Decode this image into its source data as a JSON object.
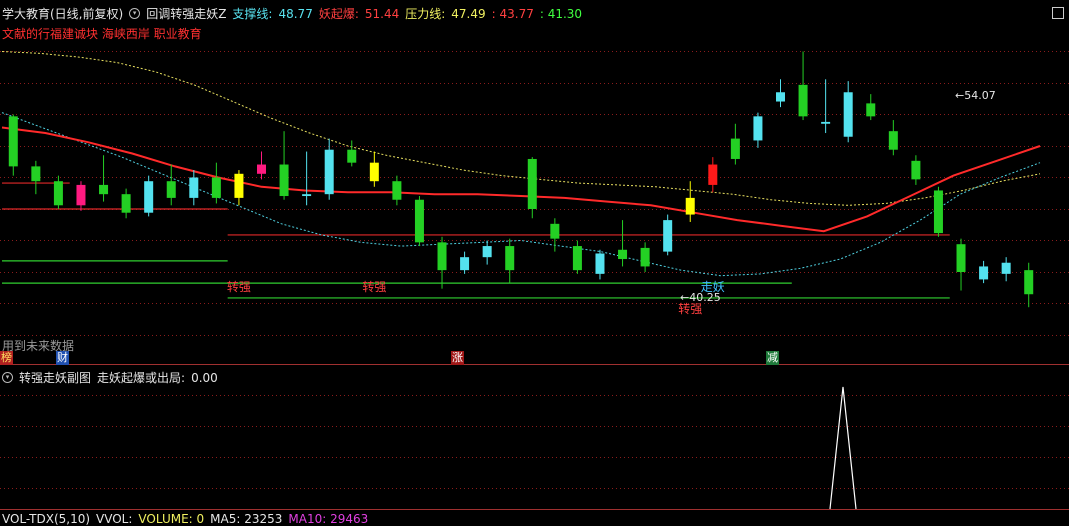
{
  "header": {
    "title": "学大教育(日线,前复权)",
    "indicator_name": "回调转强走妖Z",
    "support_label": "支撑线:",
    "support_value": "48.77",
    "yao_label": "妖起爆:",
    "yao_value": "51.44",
    "pressure_label": "压力线:",
    "pressure_value": "47.49",
    "v1": ": 43.77",
    "v2": ": 41.30"
  },
  "watermark": "文献的行福建诚块 海峡西岸 职业教育",
  "future_text": "用到未来数据",
  "badges": [
    "榜",
    "财",
    "涨",
    "减"
  ],
  "sub_panel": {
    "title": "转强走妖副图",
    "series_label": "走妖起爆或出局:",
    "series_value": "0.00"
  },
  "volume_panel": {
    "name": "VOL-TDX(5,10)",
    "vvol": "VVOL:",
    "volume_label": "VOLUME: 0",
    "ma5": "MA5: 23253",
    "ma10": "MA10: 29463"
  },
  "colors": {
    "up": "#54e2ef",
    "down": "#24d024",
    "grid": "#8a1c1c",
    "ma_red": "#ff2a2a",
    "dash_cyan": "#4fd0e0",
    "dash_yellow": "#e8e060",
    "yellow_candle": "#ffff00",
    "magenta_candle": "#ff1a80"
  },
  "chart_data": {
    "type": "candlestick",
    "y_range": [
      39.0,
      56.0
    ],
    "high_marker": "54.07",
    "low_marker": "40.25",
    "annotations": [
      {
        "text": "转强",
        "index": 10
      },
      {
        "text": "转强",
        "index": 16
      },
      {
        "text": "走妖",
        "index": 31
      },
      {
        "text": "转强",
        "index": 30
      }
    ],
    "support_lines": [
      {
        "value": 45.8,
        "from": 0,
        "to": 9,
        "color": "red"
      },
      {
        "value": 47.2,
        "from": 0,
        "to": 2,
        "color": "red"
      },
      {
        "value": 43.0,
        "from": 0,
        "to": 9,
        "color": "green"
      },
      {
        "value": 41.8,
        "from": 0,
        "to": 34,
        "color": "green"
      },
      {
        "value": 41.0,
        "from": 10,
        "to": 41,
        "color": "green"
      },
      {
        "value": 44.4,
        "from": 10,
        "to": 41,
        "color": "red"
      }
    ],
    "candles": [
      {
        "o": 50.8,
        "c": 48.1,
        "h": 50.9,
        "l": 47.6
      },
      {
        "o": 48.1,
        "c": 47.3,
        "h": 48.4,
        "l": 46.6
      },
      {
        "o": 47.3,
        "c": 46.0,
        "h": 47.6,
        "l": 45.8
      },
      {
        "o": 46.0,
        "c": 47.1,
        "h": 47.3,
        "l": 45.7
      },
      {
        "o": 47.1,
        "c": 46.6,
        "h": 48.7,
        "l": 46.2
      },
      {
        "o": 46.6,
        "c": 45.6,
        "h": 46.9,
        "l": 45.3
      },
      {
        "o": 45.6,
        "c": 47.3,
        "h": 47.6,
        "l": 45.4
      },
      {
        "o": 47.3,
        "c": 46.4,
        "h": 48.2,
        "l": 46.0
      },
      {
        "o": 46.4,
        "c": 47.5,
        "h": 47.9,
        "l": 46.0
      },
      {
        "o": 47.5,
        "c": 46.4,
        "h": 48.3,
        "l": 46.1
      },
      {
        "o": 46.4,
        "c": 47.7,
        "h": 47.9,
        "l": 46.0
      },
      {
        "o": 47.7,
        "c": 48.2,
        "h": 48.9,
        "l": 47.4
      },
      {
        "o": 48.2,
        "c": 46.5,
        "h": 50.0,
        "l": 46.3
      },
      {
        "o": 46.5,
        "c": 46.6,
        "h": 48.9,
        "l": 46.0
      },
      {
        "o": 46.6,
        "c": 49.0,
        "h": 49.6,
        "l": 46.3
      },
      {
        "o": 49.0,
        "c": 48.3,
        "h": 49.5,
        "l": 48.1
      },
      {
        "o": 48.3,
        "c": 47.3,
        "h": 48.9,
        "l": 47.0
      },
      {
        "o": 47.3,
        "c": 46.3,
        "h": 47.6,
        "l": 46.0
      },
      {
        "o": 46.3,
        "c": 44.0,
        "h": 46.5,
        "l": 43.8
      },
      {
        "o": 44.0,
        "c": 42.5,
        "h": 44.3,
        "l": 41.5
      },
      {
        "o": 42.5,
        "c": 43.2,
        "h": 43.5,
        "l": 42.3
      },
      {
        "o": 43.2,
        "c": 43.8,
        "h": 44.1,
        "l": 42.8
      },
      {
        "o": 43.8,
        "c": 42.5,
        "h": 44.2,
        "l": 41.8
      }
    ],
    "ma_red": [
      50.2,
      49.9,
      49.4,
      48.8,
      48.1,
      47.5,
      47.0,
      46.8,
      46.7,
      46.7,
      46.6,
      46.6,
      46.5,
      46.4,
      46.2,
      46.0,
      45.6,
      45.2,
      44.9,
      44.6,
      45.4,
      46.5,
      47.6,
      48.4,
      49.2
    ],
    "dash_cyan": [
      51.0,
      50.2,
      49.4,
      48.6,
      47.7,
      46.8,
      45.9,
      45.0,
      44.4,
      44.0,
      43.8,
      43.9,
      44.0,
      44.1,
      43.8,
      43.5,
      43.0,
      42.5,
      42.2,
      42.3,
      42.6,
      43.1,
      44.0,
      45.2,
      46.6,
      47.5,
      48.3
    ],
    "dash_yellow": [
      54.3,
      54.2,
      54.0,
      53.7,
      53.2,
      52.5,
      51.6,
      50.7,
      49.9,
      49.2,
      48.7,
      48.3,
      47.9,
      47.6,
      47.4,
      47.2,
      47.1,
      47.0,
      46.8,
      46.6,
      46.3,
      46.1,
      46.0,
      46.1,
      46.4,
      46.8,
      47.3,
      47.7
    ]
  }
}
